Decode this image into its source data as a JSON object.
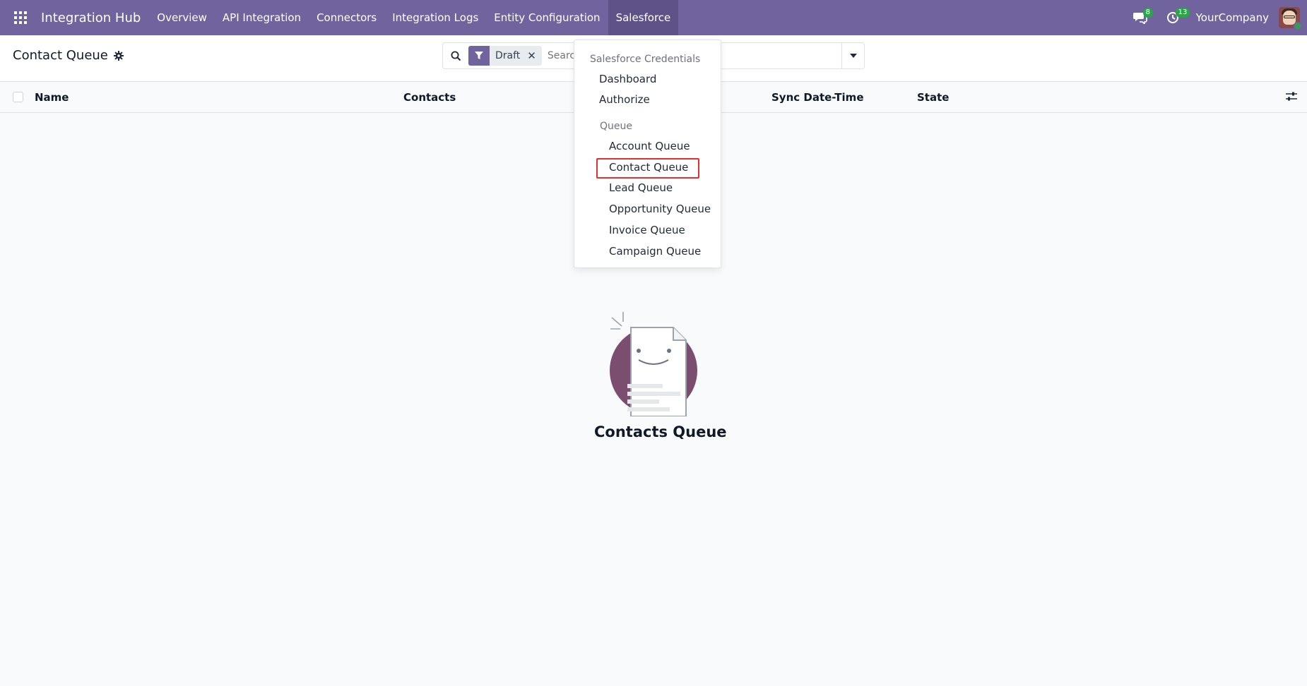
{
  "navbar": {
    "brand": "Integration Hub",
    "menu": [
      "Overview",
      "API Integration",
      "Connectors",
      "Integration Logs",
      "Entity Configuration",
      "Salesforce"
    ],
    "messages_count": "8",
    "activities_count": "13",
    "company": "YourCompany"
  },
  "control_panel": {
    "title": "Contact Queue",
    "facet_label": "Draft",
    "search_placeholder": "Search..."
  },
  "list": {
    "columns": [
      "Name",
      "Contacts",
      "Sync Date-Time",
      "State"
    ]
  },
  "empty_state": {
    "title": "Contacts Queue"
  },
  "dropdown": {
    "section_credentials": "Salesforce Credentials",
    "credentials_items": [
      "Dashboard",
      "Authorize"
    ],
    "section_queue": "Queue",
    "queue_items": [
      "Account Queue",
      "Contact Queue",
      "Lead Queue",
      "Opportunity Queue",
      "Invoice Queue",
      "Campaign Queue"
    ]
  },
  "colors": {
    "brand": "#71639e",
    "highlight": "#e0302f",
    "badge": "#28a745"
  }
}
